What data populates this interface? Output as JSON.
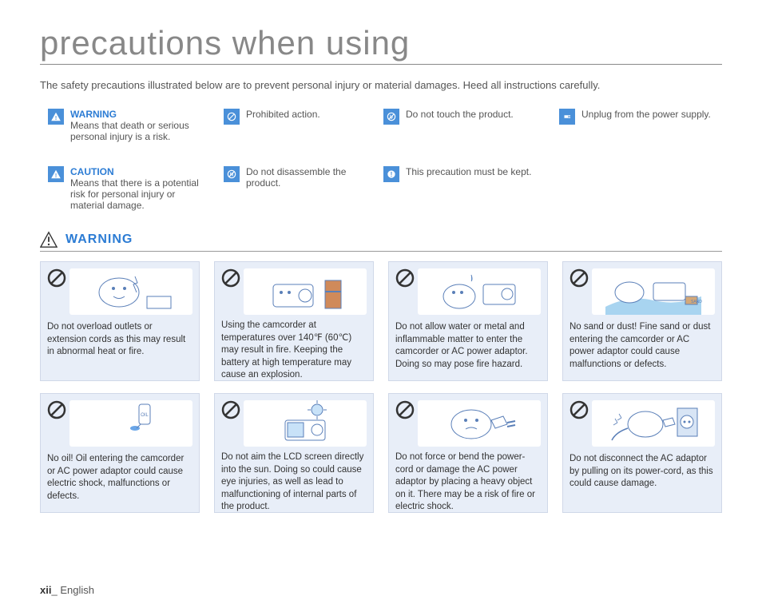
{
  "title": "precautions when using",
  "intro": "The safety precautions illustrated below are to prevent personal injury or material damages. Heed all instructions carefully.",
  "legend": {
    "warning_label": "WARNING",
    "warning_text": "Means that death or serious personal injury is a risk.",
    "caution_label": "CAUTION",
    "caution_text": "Means that there is a potential risk for personal injury or material damage.",
    "prohibited": "Prohibited action.",
    "disassemble": "Do not disassemble the product.",
    "touch": "Do not touch the product.",
    "keep": "This precaution must be kept.",
    "unplug": "Unplug from the power supply."
  },
  "section_heading": "WARNING",
  "cards": [
    {
      "text": "Do not overload outlets or extension cords as this may result in abnormal heat or fire."
    },
    {
      "text": "Using the camcorder at temperatures over 140℉ (60℃) may result in fire. Keeping the battery at high temperature may cause an explosion."
    },
    {
      "text": "Do not allow water or metal and inflammable matter to enter the camcorder or AC power adaptor. Doing so may pose fire hazard."
    },
    {
      "text": "No sand or dust! Fine sand or dust entering the camcorder or AC power adaptor could cause malfunctions or defects."
    },
    {
      "text": "No oil! Oil entering the camcorder or AC power adaptor could cause electric shock, malfunctions or defects."
    },
    {
      "text": "Do not aim the LCD screen directly into the sun. Doing so could cause eye injuries, as well as lead to malfunctioning of internal parts of the product."
    },
    {
      "text": "Do not force or bend the power-cord or damage the AC power adaptor by placing a heavy object on it. There may be a risk of fire or electric shock."
    },
    {
      "text": "Do not disconnect the AC adaptor by pulling on its power-cord, as this could cause damage."
    }
  ],
  "footer_page": "xii",
  "footer_lang": "English"
}
